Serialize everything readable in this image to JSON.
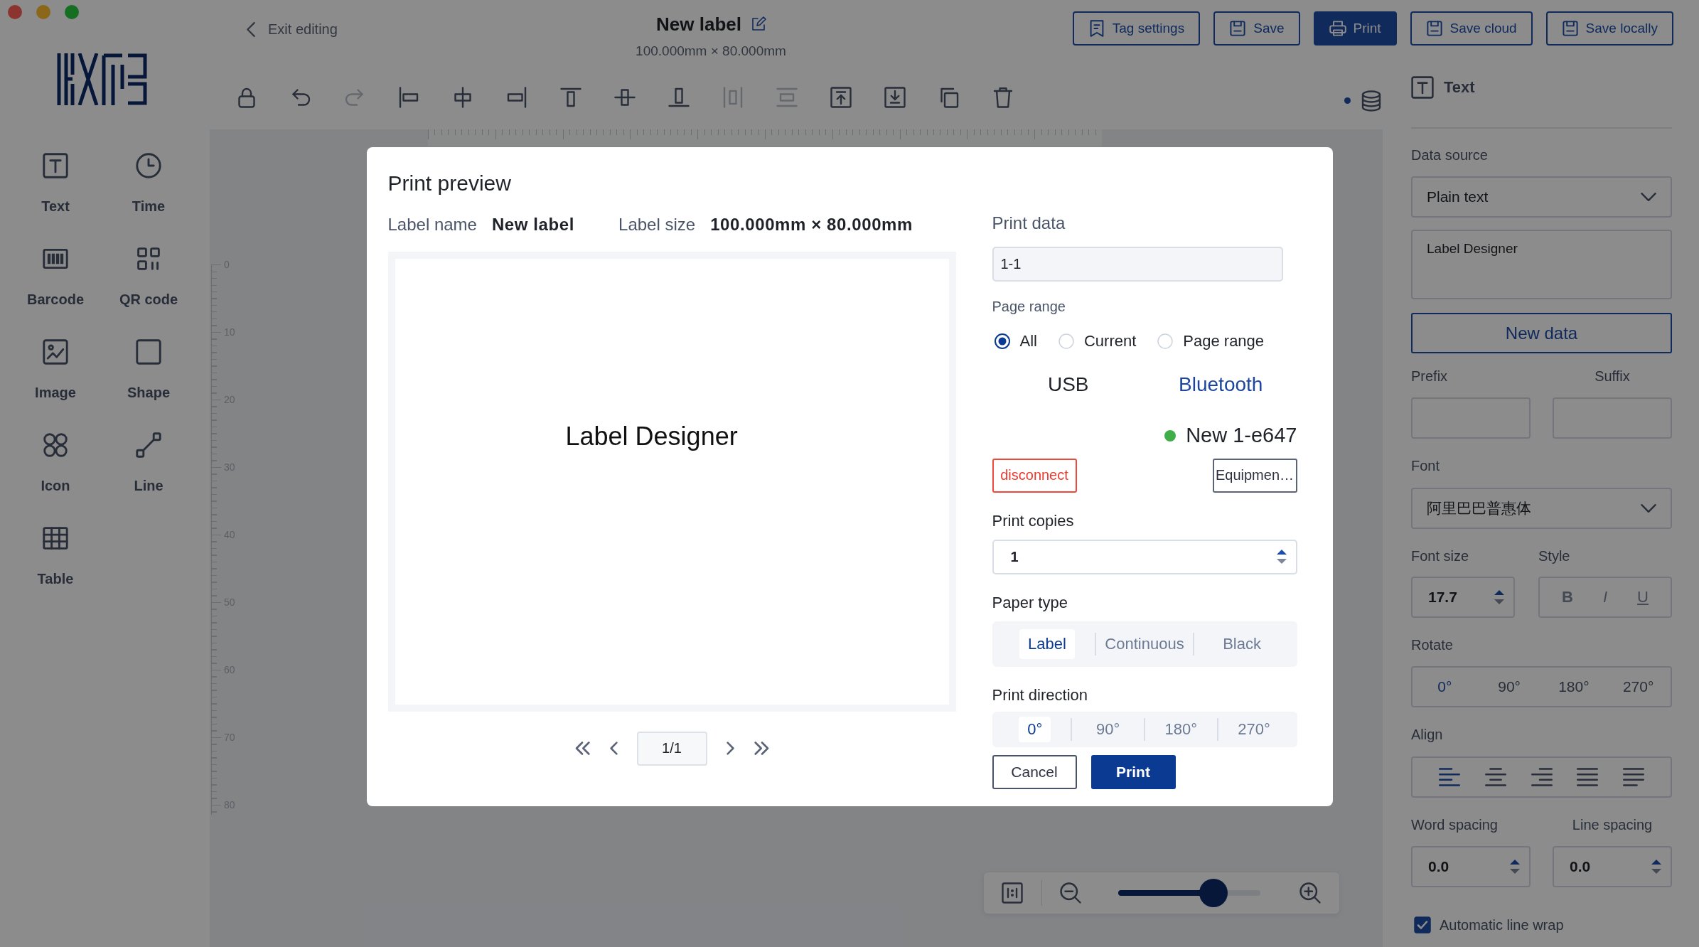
{
  "header": {
    "back_link": "Exit editing",
    "title": "New label",
    "subtitle": "100.000mm × 80.000mm",
    "buttons": [
      {
        "label": "Tag settings",
        "kind": "tag",
        "primary": false
      },
      {
        "label": "Save",
        "kind": "save",
        "primary": false
      },
      {
        "label": "Print",
        "kind": "print",
        "primary": true
      },
      {
        "label": "Save cloud",
        "kind": "save",
        "primary": false
      },
      {
        "label": "Save locally",
        "kind": "save",
        "primary": false
      }
    ]
  },
  "tools": [
    {
      "label": "Text",
      "kind": "text"
    },
    {
      "label": "Time",
      "kind": "time"
    },
    {
      "label": "Barcode",
      "kind": "barcode"
    },
    {
      "label": "QR code",
      "kind": "qrcode"
    },
    {
      "label": "Image",
      "kind": "image"
    },
    {
      "label": "Shape",
      "kind": "shape"
    },
    {
      "label": "Icon",
      "kind": "icon"
    },
    {
      "label": "Line",
      "kind": "line"
    },
    {
      "label": "Table",
      "kind": "table"
    }
  ],
  "toolbar": [
    {
      "kind": "lock",
      "disabled": false
    },
    {
      "kind": "undo",
      "disabled": false
    },
    {
      "kind": "redo",
      "disabled": true
    },
    {
      "kind": "alignleft",
      "disabled": false
    },
    {
      "kind": "aligncenter",
      "disabled": false
    },
    {
      "kind": "alignright",
      "disabled": false
    },
    {
      "kind": "aligntop",
      "disabled": false
    },
    {
      "kind": "alignmiddle",
      "disabled": false
    },
    {
      "kind": "alignbottom",
      "disabled": false
    },
    {
      "kind": "distributeh",
      "disabled": true
    },
    {
      "kind": "distributev",
      "disabled": true
    },
    {
      "kind": "front",
      "disabled": false
    },
    {
      "kind": "back",
      "disabled": false
    },
    {
      "kind": "copy",
      "disabled": false
    },
    {
      "kind": "delete",
      "disabled": false
    }
  ],
  "ruler": {
    "vertical_labels": [
      "0",
      "10",
      "20",
      "30",
      "40",
      "50",
      "60",
      "70",
      "80"
    ]
  },
  "zoom": {
    "level": 0.71
  },
  "properties": {
    "title": "Text",
    "data_source": {
      "label": "Data source",
      "value": "Plain text"
    },
    "content": "Label Designer",
    "new_data_button": "New data",
    "prefix": {
      "label": "Prefix"
    },
    "suffix": {
      "label": "Suffix"
    },
    "font": {
      "label": "Font",
      "value": "阿里巴巴普惠体"
    },
    "font_size": {
      "label": "Font size",
      "value": "17.7"
    },
    "style": {
      "label": "Style",
      "options": [
        {
          "text": "B",
          "kind": "bold",
          "selected": false
        },
        {
          "text": "I",
          "kind": "italic",
          "selected": false
        },
        {
          "text": "U",
          "kind": "underline",
          "selected": false
        }
      ]
    },
    "rotate": {
      "label": "Rotate",
      "options": [
        {
          "label": "0°",
          "selected": true
        },
        {
          "label": "90°",
          "selected": false
        },
        {
          "label": "180°",
          "selected": false
        },
        {
          "label": "270°",
          "selected": false
        }
      ]
    },
    "align": {
      "label": "Align",
      "options": [
        {
          "kind": "left",
          "selected": true
        },
        {
          "kind": "center",
          "selected": false
        },
        {
          "kind": "right",
          "selected": false
        },
        {
          "kind": "justify",
          "selected": false
        },
        {
          "kind": "distributed",
          "selected": false
        }
      ]
    },
    "word_spacing": {
      "label": "Word spacing",
      "value": "0.0"
    },
    "line_spacing": {
      "label": "Line spacing",
      "value": "0.0"
    },
    "auto_wrap": {
      "label": "Automatic line wrap",
      "checked": true
    }
  },
  "dialog": {
    "title": "Print preview",
    "label_name": {
      "label": "Label name",
      "value": "New label"
    },
    "label_size": {
      "label": "Label size",
      "value": "100.000mm × 80.000mm"
    },
    "preview_text": "Label Designer",
    "pager": {
      "value": "1/1"
    },
    "print_data": {
      "label": "Print data",
      "value": "1-1"
    },
    "page_range": {
      "label": "Page range",
      "options": [
        {
          "label": "All",
          "selected": true
        },
        {
          "label": "Current",
          "selected": false
        },
        {
          "label": "Page range",
          "selected": false
        }
      ]
    },
    "connection_tabs": [
      {
        "label": "USB",
        "selected": false
      },
      {
        "label": "Bluetooth",
        "selected": true
      }
    ],
    "device": {
      "name": "New 1-e647",
      "connected": true
    },
    "disconnect_button": "disconnect",
    "equipment_button": "Equipmen…",
    "copies": {
      "label": "Print copies",
      "value": "1"
    },
    "paper_type": {
      "label": "Paper type",
      "options": [
        {
          "label": "Label",
          "selected": true
        },
        {
          "label": "Continuous",
          "selected": false
        },
        {
          "label": "Black",
          "selected": false
        }
      ]
    },
    "direction": {
      "label": "Print direction",
      "options": [
        {
          "label": "0°",
          "selected": true
        },
        {
          "label": "90°",
          "selected": false
        },
        {
          "label": "180°",
          "selected": false
        },
        {
          "label": "270°",
          "selected": false
        }
      ]
    },
    "buttons": [
      {
        "label": "Cancel",
        "primary": false
      },
      {
        "label": "Print",
        "primary": true
      }
    ]
  }
}
